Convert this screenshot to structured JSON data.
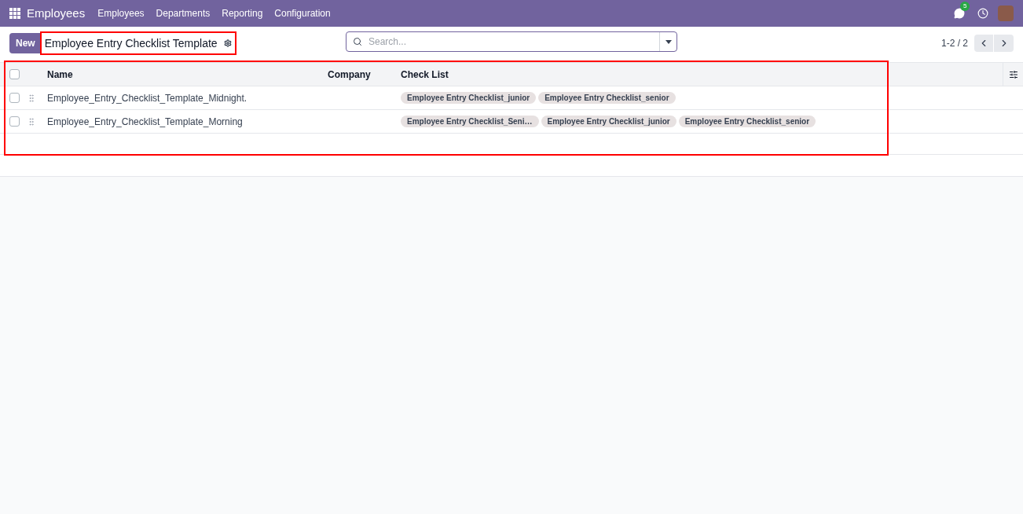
{
  "navbar": {
    "app_name": "Employees",
    "menu": [
      "Employees",
      "Departments",
      "Reporting",
      "Configuration"
    ],
    "message_count": "5"
  },
  "control_panel": {
    "new_button": "New",
    "title": "Employee Entry Checklist Template",
    "title_highlighted": true,
    "search": {
      "placeholder": "Search..."
    },
    "pager": "1-2 / 2"
  },
  "table": {
    "highlighted": true,
    "columns": [
      "Name",
      "Company",
      "Check List"
    ],
    "all_checked": false,
    "rows": [
      {
        "checked": false,
        "name": "Employee_Entry_Checklist_Template_Midnight.",
        "company": "",
        "tags": [
          "Employee Entry Checklist_junior",
          "Employee Entry Checklist_senior"
        ]
      },
      {
        "checked": false,
        "name": "Employee_Entry_Checklist_Template_Morning",
        "company": "",
        "tags": [
          "Employee Entry Checklist_Seni…",
          "Employee Entry Checklist_junior",
          "Employee Entry Checklist_senior"
        ]
      }
    ]
  }
}
